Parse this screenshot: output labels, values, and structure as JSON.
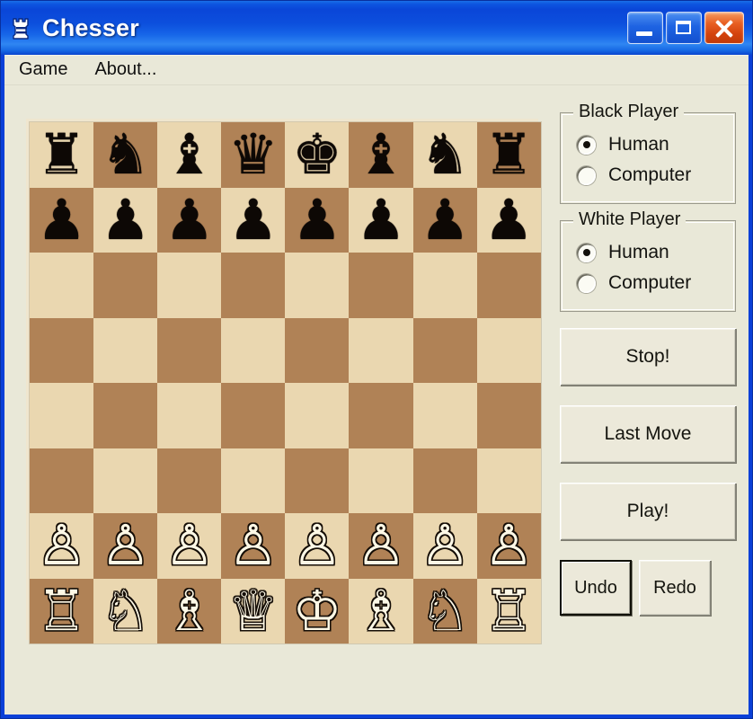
{
  "window": {
    "title": "Chesser",
    "icon": "rook-icon",
    "controls": {
      "minimize": "Minimize",
      "maximize": "Maximize",
      "close": "Close"
    },
    "colors": {
      "titlebar_blue": "#0a46d8",
      "close_red": "#e85f22",
      "client_bg": "#e9e8d8",
      "board_light": "#ead7b0",
      "board_dark": "#b08256"
    }
  },
  "menu": {
    "items": [
      {
        "label": "Game"
      },
      {
        "label": "About..."
      }
    ]
  },
  "board": {
    "orientation": "white-bottom",
    "rows": [
      [
        "r",
        "n",
        "b",
        "q",
        "k",
        "b",
        "n",
        "r"
      ],
      [
        "p",
        "p",
        "p",
        "p",
        "p",
        "p",
        "p",
        "p"
      ],
      [
        "",
        "",
        "",
        "",
        "",
        "",
        "",
        ""
      ],
      [
        "",
        "",
        "",
        "",
        "",
        "",
        "",
        ""
      ],
      [
        "",
        "",
        "",
        "",
        "",
        "",
        "",
        ""
      ],
      [
        "",
        "",
        "",
        "",
        "",
        "",
        "",
        ""
      ],
      [
        "P",
        "P",
        "P",
        "P",
        "P",
        "P",
        "P",
        "P"
      ],
      [
        "R",
        "N",
        "B",
        "Q",
        "K",
        "B",
        "N",
        "R"
      ]
    ],
    "glyphs": {
      "K": "♔",
      "Q": "♕",
      "R": "♖",
      "B": "♗",
      "N": "♘",
      "P": "♙",
      "k": "♚",
      "q": "♛",
      "r": "♜",
      "b": "♝",
      "n": "♞",
      "p": "♟"
    }
  },
  "panel": {
    "black_player": {
      "title": "Black Player",
      "options": [
        {
          "label": "Human",
          "checked": true
        },
        {
          "label": "Computer",
          "checked": false
        }
      ]
    },
    "white_player": {
      "title": "White Player",
      "options": [
        {
          "label": "Human",
          "checked": true
        },
        {
          "label": "Computer",
          "checked": false
        }
      ]
    },
    "buttons": {
      "stop": "Stop!",
      "last_move": "Last Move",
      "play": "Play!",
      "undo": "Undo",
      "redo": "Redo"
    }
  }
}
